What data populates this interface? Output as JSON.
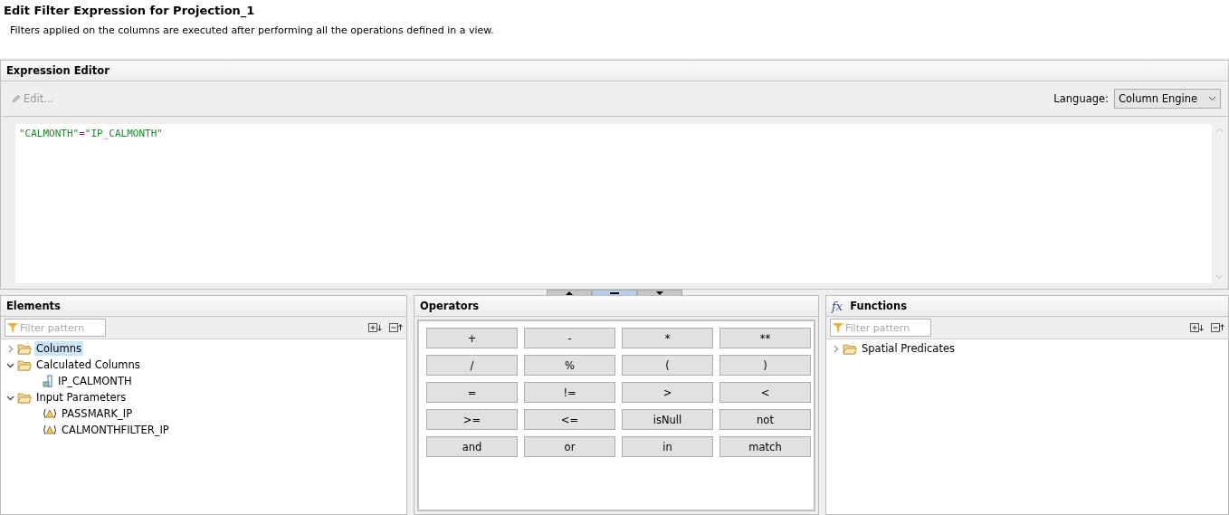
{
  "dialog": {
    "title": "Edit Filter Expression for Projection_1",
    "description": "Filters applied on the columns are executed after performing all the operations defined in a view."
  },
  "expression_editor": {
    "title": "Expression Editor",
    "edit_button": {
      "label": "Edit...",
      "disabled": true
    },
    "language_label": "Language:",
    "language_value": "Column Engine",
    "expression": [
      {
        "kind": "string",
        "text": "\"CALMONTH\""
      },
      {
        "kind": "operator",
        "text": "="
      },
      {
        "kind": "string",
        "text": "\"IP_CALMONTH\""
      }
    ]
  },
  "elements": {
    "title": "Elements",
    "filter_placeholder": "Filter pattern",
    "items": [
      {
        "label": "Columns",
        "kind": "folder",
        "expanded": false,
        "selected": true
      },
      {
        "label": "Calculated Columns",
        "kind": "folder",
        "expanded": true,
        "selected": false,
        "children": [
          {
            "label": "IP_CALMONTH",
            "kind": "calculated",
            "selected": false
          }
        ]
      },
      {
        "label": "Input Parameters",
        "kind": "folder",
        "expanded": true,
        "selected": false,
        "children": [
          {
            "label": "PASSMARK_IP",
            "kind": "parameter",
            "selected": false
          },
          {
            "label": "CALMONTHFILTER_IP",
            "kind": "parameter",
            "selected": false
          }
        ]
      }
    ]
  },
  "operators": {
    "title": "Operators",
    "buttons": [
      "+",
      "-",
      "*",
      "**",
      "/",
      "%",
      "(",
      ")",
      "=",
      "!=",
      ">",
      "<",
      ">=",
      "<=",
      "isNull",
      "not",
      "and",
      "or",
      "in",
      "match"
    ]
  },
  "functions": {
    "title": "Functions",
    "icon_text": "fx",
    "filter_placeholder": "Filter pattern",
    "items": [
      {
        "label": "Spatial Predicates",
        "kind": "folder",
        "expanded": false,
        "selected": false
      }
    ]
  }
}
